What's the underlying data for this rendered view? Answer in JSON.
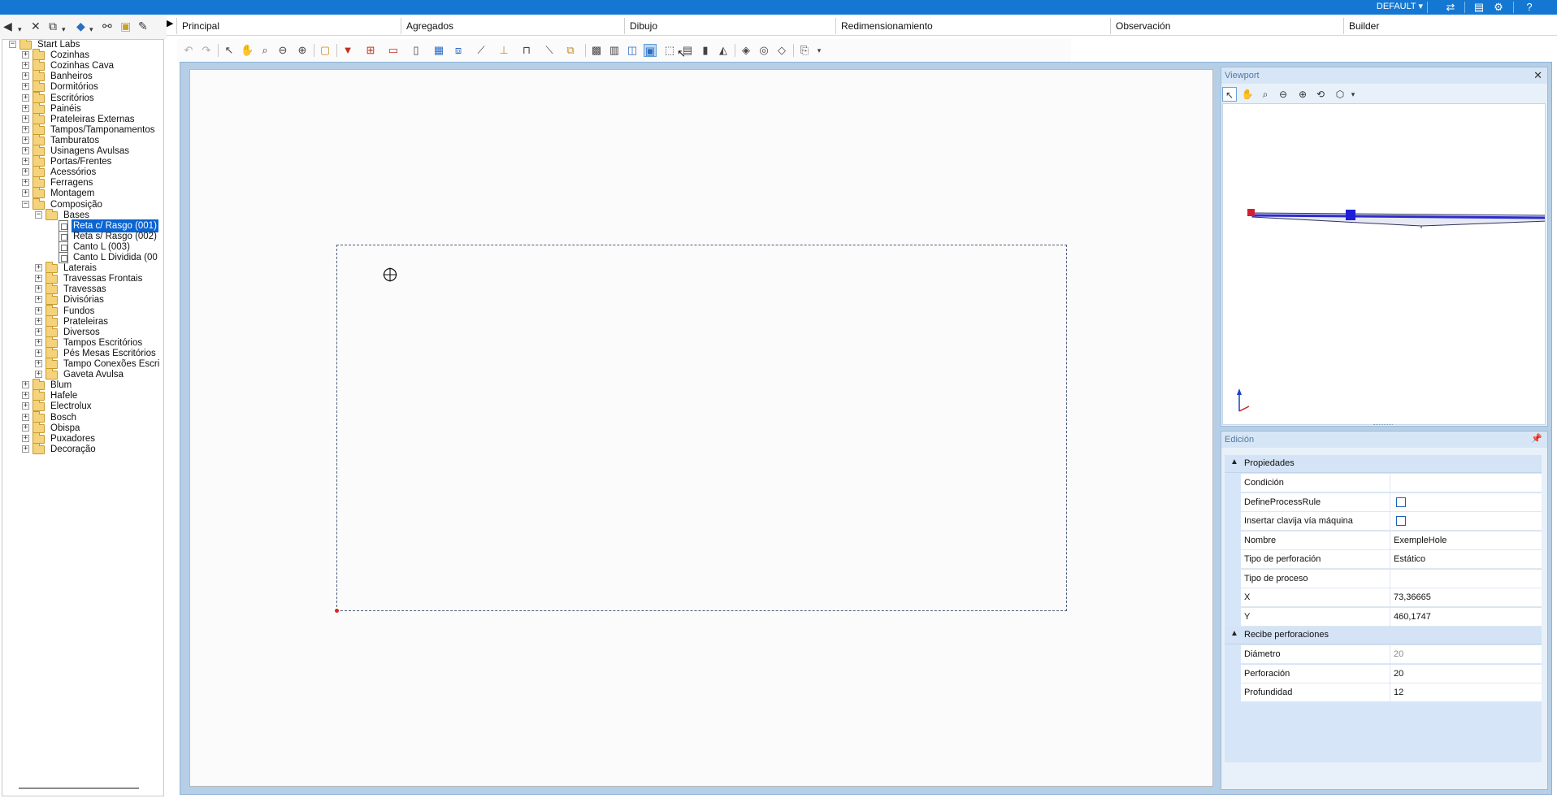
{
  "titlebar": {
    "profile": "DEFAULT",
    "icons": [
      "dropdown-arrow",
      "sync-icon",
      "layout-icon",
      "settings-icon",
      "help-icon"
    ]
  },
  "tree": {
    "nodes": [
      {
        "label": "Start Labs",
        "level": 0,
        "expanded": true
      },
      {
        "label": "Cozinhas",
        "level": 1
      },
      {
        "label": "Cozinhas Cava",
        "level": 1
      },
      {
        "label": "Banheiros",
        "level": 1
      },
      {
        "label": "Dormitórios",
        "level": 1
      },
      {
        "label": "Escritórios",
        "level": 1
      },
      {
        "label": "Painéis",
        "level": 1
      },
      {
        "label": "Prateleiras Externas",
        "level": 1
      },
      {
        "label": "Tampos/Tamponamentos",
        "level": 1
      },
      {
        "label": "Tamburatos",
        "level": 1
      },
      {
        "label": "Usinagens Avulsas",
        "level": 1
      },
      {
        "label": "Portas/Frentes",
        "level": 1
      },
      {
        "label": "Acessórios",
        "level": 1
      },
      {
        "label": "Ferragens",
        "level": 1
      },
      {
        "label": "Montagem",
        "level": 1
      },
      {
        "label": "Composição",
        "level": 1,
        "expanded": true
      },
      {
        "label": "Bases",
        "level": 2,
        "expanded": true
      },
      {
        "label": "Reta c/ Rasgo (001)",
        "level": 3,
        "type": "doc",
        "selected": true
      },
      {
        "label": "Reta s/ Rasgo (002)",
        "level": 3,
        "type": "doc"
      },
      {
        "label": "Canto L (003)",
        "level": 3,
        "type": "doc"
      },
      {
        "label": "Canto L Dividida (00",
        "level": 3,
        "type": "doc"
      },
      {
        "label": "Laterais",
        "level": 2
      },
      {
        "label": "Travessas Frontais",
        "level": 2
      },
      {
        "label": "Travessas",
        "level": 2
      },
      {
        "label": "Divisórias",
        "level": 2
      },
      {
        "label": "Fundos",
        "level": 2
      },
      {
        "label": "Prateleiras",
        "level": 2
      },
      {
        "label": "Diversos",
        "level": 2
      },
      {
        "label": "Tampos Escritórios",
        "level": 2
      },
      {
        "label": "Pés Mesas Escritórios",
        "level": 2
      },
      {
        "label": "Tampo Conexões Escri",
        "level": 2
      },
      {
        "label": "Gaveta Avulsa",
        "level": 2
      },
      {
        "label": "Blum",
        "level": 1
      },
      {
        "label": "Hafele",
        "level": 1
      },
      {
        "label": "Electrolux",
        "level": 1
      },
      {
        "label": "Bosch",
        "level": 1
      },
      {
        "label": "Obispa",
        "level": 1
      },
      {
        "label": "Puxadores",
        "level": 1
      },
      {
        "label": "Decoração",
        "level": 1
      }
    ]
  },
  "ribbon": {
    "tabs": [
      "Principal",
      "Agregados",
      "Dibujo",
      "Redimensionamiento",
      "Observación",
      "Builder"
    ]
  },
  "viewport": {
    "title": "Viewport",
    "close": "✕"
  },
  "edit": {
    "title": "Edición",
    "categories": [
      {
        "name": "Propiedades",
        "rows": [
          {
            "name": "Condición",
            "value": ""
          },
          {
            "name": "DefineProcessRule",
            "value": "",
            "checkbox": true
          },
          {
            "name": "Insertar clavija vía máquina",
            "value": "",
            "checkbox": true
          },
          {
            "name": "Nombre",
            "value": "ExempleHole"
          },
          {
            "name": "Tipo de perforación",
            "value": "Estático"
          },
          {
            "name": "Tipo de proceso",
            "value": ""
          },
          {
            "name": "X",
            "value": "73,36665"
          },
          {
            "name": "Y",
            "value": "460,1747"
          }
        ]
      },
      {
        "name": "Recibe perforaciones",
        "rows": [
          {
            "name": "Diámetro",
            "value": "20",
            "muted": true
          },
          {
            "name": "Perforación",
            "value": "20"
          },
          {
            "name": "Profundidad",
            "value": "12"
          }
        ]
      }
    ]
  },
  "colors": {
    "titlebar": "#1478d2",
    "selection": "#0a64d2",
    "canvas_border": "#b6cfe6",
    "part_outline": "#4e5d7a",
    "viewport_model": "#2c2ccc"
  }
}
